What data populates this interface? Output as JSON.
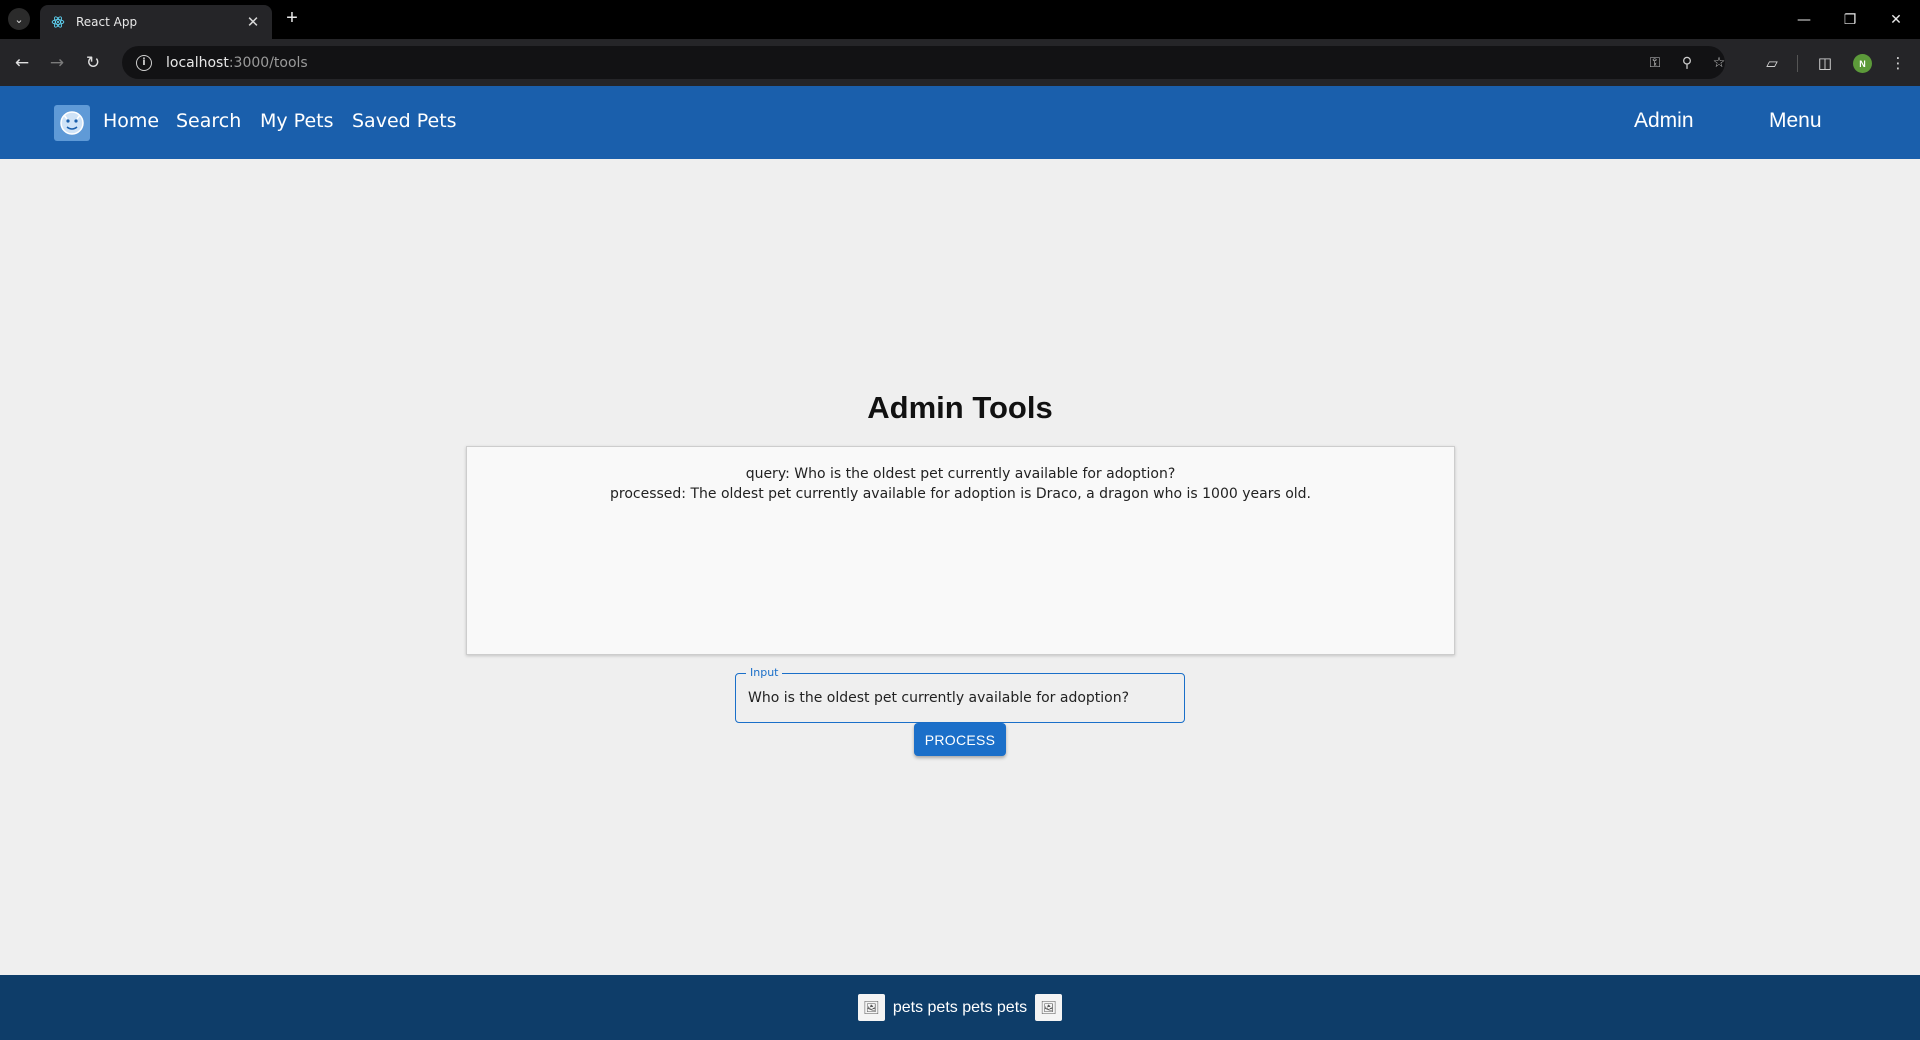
{
  "browser": {
    "tab_title": "React App",
    "url_host": "localhost",
    "url_path": ":3000/tools",
    "profile_initial": "N"
  },
  "header": {
    "nav": [
      "Home",
      "Search",
      "My Pets",
      "Saved Pets"
    ],
    "admin_label": "Admin",
    "menu_label": "Menu"
  },
  "main": {
    "title": "Admin Tools",
    "output": {
      "query_line": "query: Who is the oldest pet currently available for adoption?",
      "processed_line": "processed: The oldest pet currently available for adoption is Draco, a dragon who is 1000 years old."
    },
    "input": {
      "label": "Input",
      "value": "Who is the oldest pet currently available for adoption?"
    },
    "process_button": "PROCESS"
  },
  "footer": {
    "text": "pets pets pets pets"
  },
  "colors": {
    "header_bg": "#1a5fac",
    "footer_bg": "#0e3d69",
    "accent": "#1b6fc9"
  }
}
